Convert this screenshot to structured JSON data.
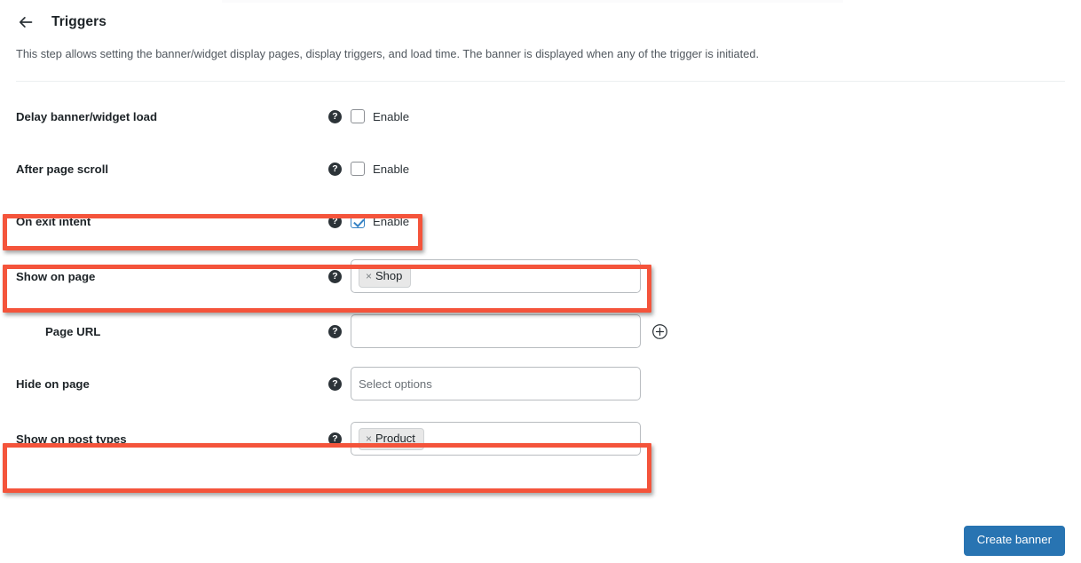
{
  "header": {
    "back_icon": "arrow-left-icon",
    "title": "Triggers"
  },
  "description": "This step allows setting the banner/widget display pages, display triggers, and load time. The banner is displayed when any of the trigger is initiated.",
  "help_icon_glyph": "?",
  "rows": [
    {
      "label": "Delay banner/widget load",
      "type": "checkbox",
      "checkbox_label": "Enable",
      "checked": false,
      "highlighted": false
    },
    {
      "label": "After page scroll",
      "type": "checkbox",
      "checkbox_label": "Enable",
      "checked": false,
      "highlighted": false
    },
    {
      "label": "On exit intent",
      "type": "checkbox",
      "checkbox_label": "Enable",
      "checked": true,
      "highlighted": true
    },
    {
      "label": "Show on page",
      "type": "tags",
      "tags": [
        "Shop"
      ],
      "tag_remove_glyph": "×",
      "placeholder": "",
      "highlighted": true
    },
    {
      "label": "Page URL",
      "type": "text",
      "value": "",
      "placeholder": "",
      "indent": true,
      "add_icon": "plus-circle-icon",
      "highlighted": false
    },
    {
      "label": "Hide on page",
      "type": "select",
      "value": "",
      "placeholder": "Select options",
      "highlighted": false
    },
    {
      "label": "Show on post types",
      "type": "tags",
      "tags": [
        "Product"
      ],
      "tag_remove_glyph": "×",
      "placeholder": "",
      "highlighted": true
    }
  ],
  "footer": {
    "primary_button": "Create banner"
  },
  "colors": {
    "accent_blue": "#2874b2",
    "checkbox_blue": "#3582c4",
    "highlight_red": "#f4543b",
    "help_dark": "#2c3338",
    "chip_bg": "#e8e8e8"
  }
}
